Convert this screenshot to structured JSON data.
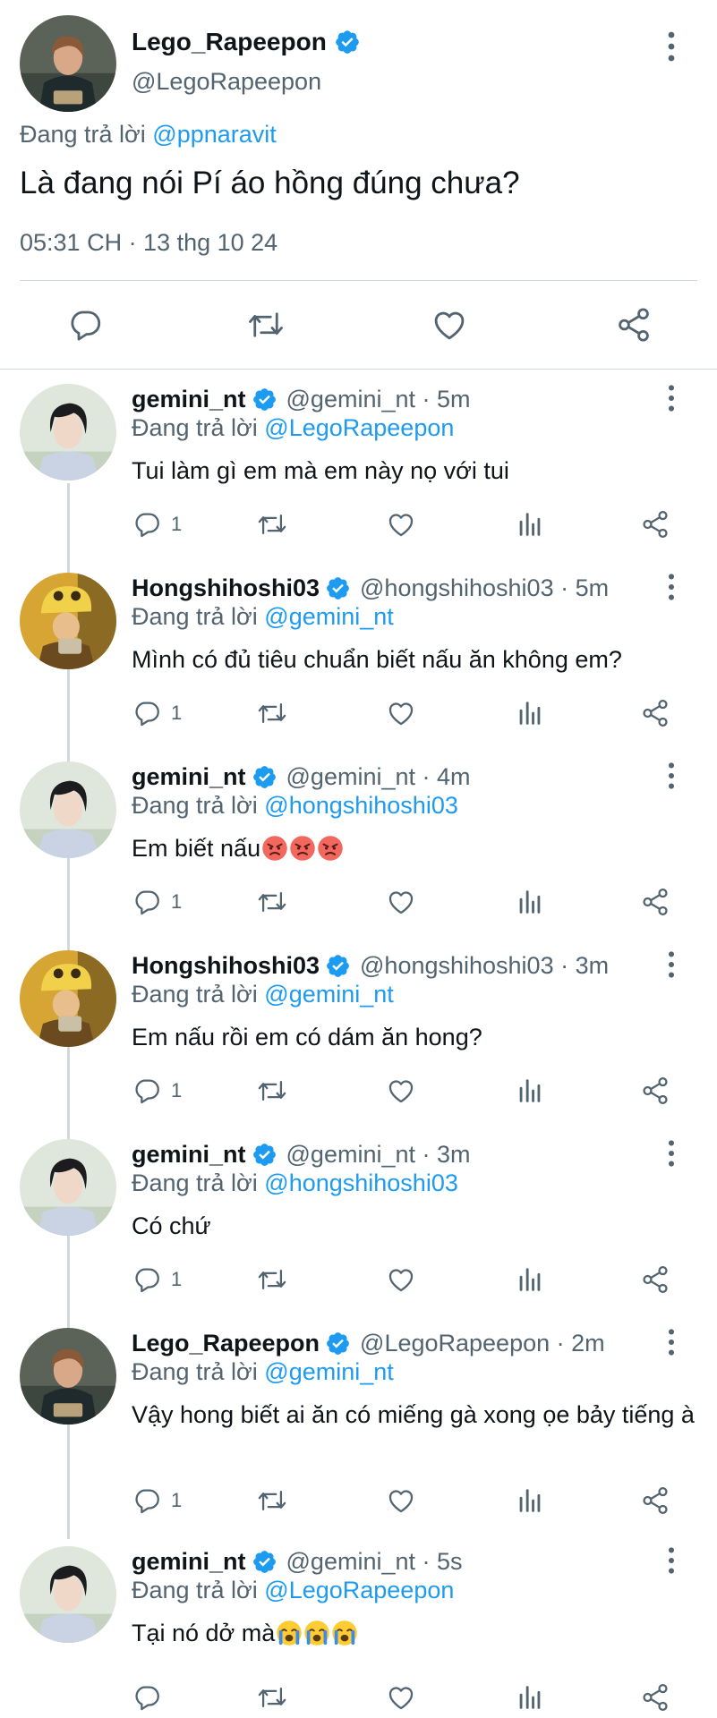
{
  "main_tweet": {
    "display_name": "Lego_Rapeepon",
    "handle": "@LegoRapeepon",
    "reply_prefix": "Đang trả lời",
    "reply_to": "@ppnaravit",
    "text": "Là đang nói Pí áo hồng đúng chưa?",
    "timestamp": "05:31 CH · 13 thg 10 24",
    "actions": [
      "reply-icon",
      "retweet-icon",
      "like-icon",
      "share-icon"
    ]
  },
  "replies": [
    {
      "display_name": "gemini_nt",
      "handle": "@gemini_nt · 5m",
      "reply_prefix": "Đang trả lời",
      "reply_to": "@LegoRapeepon",
      "text": "Tui làm gì em mà em này nọ với tui",
      "reply_count": "1",
      "avatar": "gemini"
    },
    {
      "display_name": "Hongshihoshi03",
      "handle": "@hongshihoshi03 · 5m",
      "reply_prefix": "Đang trả lời",
      "reply_to": "@gemini_nt",
      "text": "Mình có đủ tiêu chuẩn biết nấu ăn không em?",
      "reply_count": "1",
      "avatar": "hong"
    },
    {
      "display_name": "gemini_nt",
      "handle": "@gemini_nt · 4m",
      "reply_prefix": "Đang trả lời",
      "reply_to": "@hongshihoshi03",
      "text": "Em biết nấu",
      "emoji": "angry-face",
      "reply_count": "1",
      "avatar": "gemini"
    },
    {
      "display_name": "Hongshihoshi03",
      "handle": "@hongshihoshi03 · 3m",
      "reply_prefix": "Đang trả lời",
      "reply_to": "@gemini_nt",
      "text": "Em nấu rồi em có dám ăn hong?",
      "reply_count": "1",
      "avatar": "hong"
    },
    {
      "display_name": "gemini_nt",
      "handle": "@gemini_nt · 3m",
      "reply_prefix": "Đang trả lời",
      "reply_to": "@hongshihoshi03",
      "text": "Có chứ",
      "reply_count": "1",
      "avatar": "gemini"
    },
    {
      "display_name": "Lego_Rapeepon",
      "handle": "@LegoRapeepon · 2m",
      "reply_prefix": "Đang trả lời",
      "reply_to": "@gemini_nt",
      "text": "Vậy hong biết ai ăn có miếng gà xong ọe bảy tiếng à",
      "reply_count": "1",
      "avatar": "lego"
    },
    {
      "display_name": "gemini_nt",
      "handle": "@gemini_nt · 5s",
      "reply_prefix": "Đang trả lời",
      "reply_to": "@LegoRapeepon",
      "text": "Tại nó dở mà",
      "emoji": "crying-face",
      "reply_count": "",
      "avatar": "gemini"
    }
  ],
  "colors": {
    "accent": "#1d9bf0",
    "secondary_text": "#536471",
    "border": "#cfd9de"
  }
}
